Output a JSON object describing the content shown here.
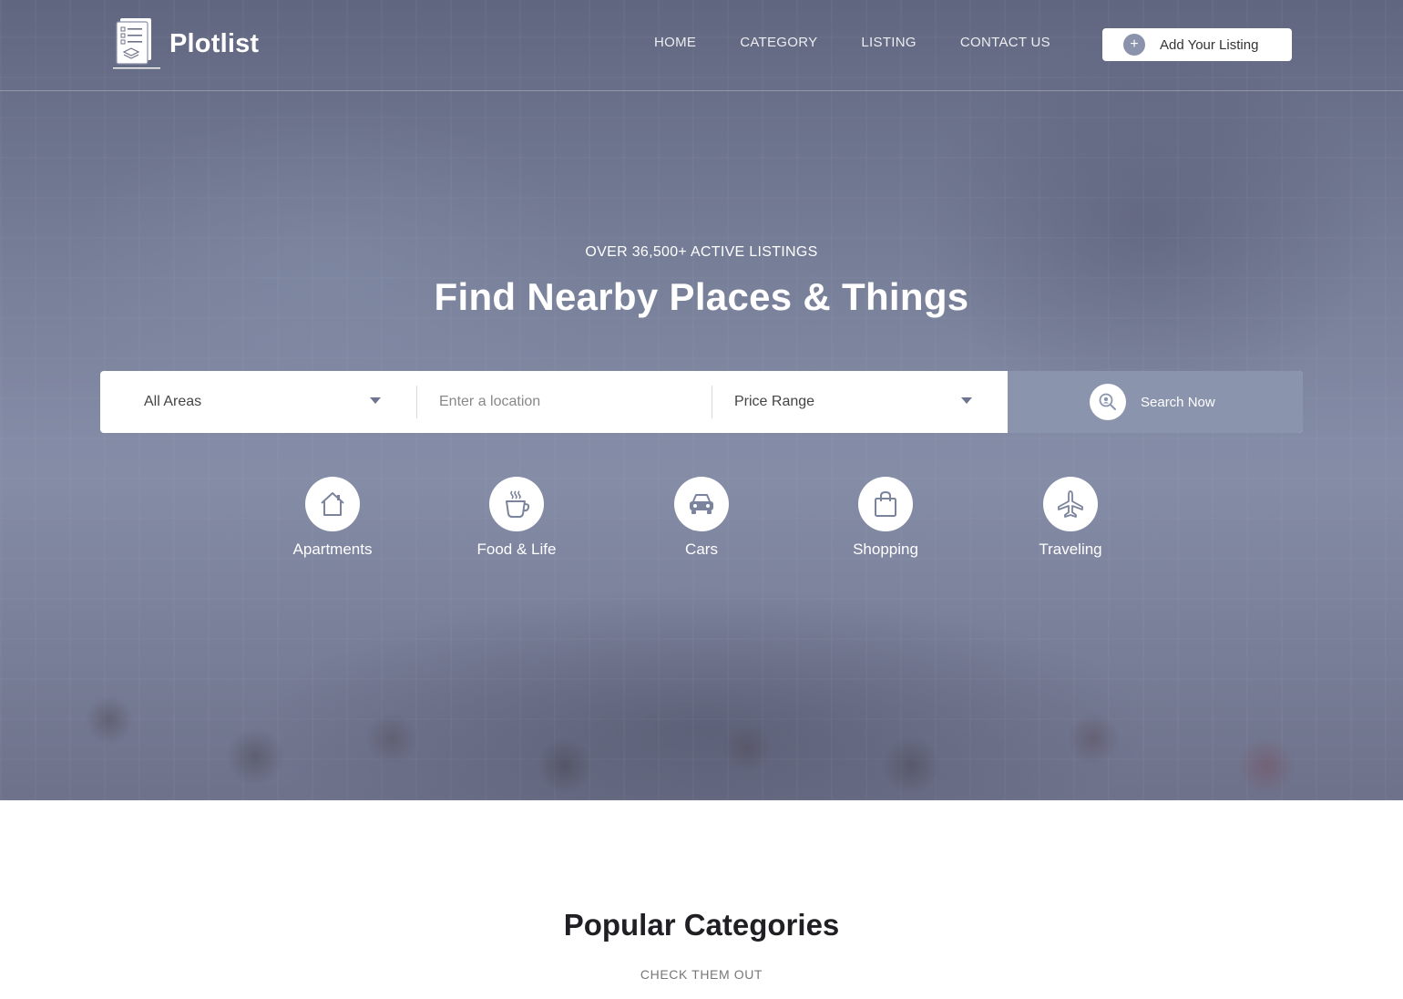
{
  "brand": {
    "name": "Plotlist"
  },
  "nav": {
    "items": [
      {
        "label": "HOME"
      },
      {
        "label": "CATEGORY"
      },
      {
        "label": "LISTING"
      },
      {
        "label": "CONTACT US"
      }
    ],
    "cta_label": "Add Your Listing"
  },
  "hero": {
    "kicker": "OVER 36,500+ ACTIVE LISTINGS",
    "headline": "Find Nearby Places & Things"
  },
  "search": {
    "area_value": "All Areas",
    "location_placeholder": "Enter a location",
    "price_value": "Price Range",
    "button_label": "Search Now"
  },
  "categories": [
    {
      "label": "Apartments",
      "icon": "house-icon"
    },
    {
      "label": "Food & Life",
      "icon": "coffee-cup-icon"
    },
    {
      "label": "Cars",
      "icon": "car-icon"
    },
    {
      "label": "Shopping",
      "icon": "shopping-bag-icon"
    },
    {
      "label": "Traveling",
      "icon": "airplane-icon"
    }
  ],
  "popular": {
    "title": "Popular Categories",
    "subtitle": "CHECK THEM OUT"
  },
  "colors": {
    "accent": "#8a94ac",
    "icon_stroke": "#7b849c",
    "text_dark": "#1f1f24"
  }
}
